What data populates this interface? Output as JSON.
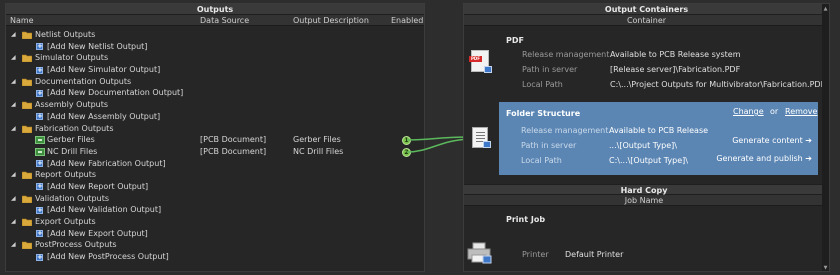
{
  "outputs_panel": {
    "title": "Outputs",
    "columns": {
      "name": "Name",
      "data_source": "Data Source",
      "output_description": "Output Description",
      "enabled": "Enabled"
    },
    "rows": [
      {
        "label": "Netlist Outputs",
        "type": "group"
      },
      {
        "label": "[Add New Netlist Output]",
        "type": "add"
      },
      {
        "label": "Simulator Outputs",
        "type": "group"
      },
      {
        "label": "[Add New Simulator Output]",
        "type": "add"
      },
      {
        "label": "Documentation Outputs",
        "type": "group"
      },
      {
        "label": "[Add New Documentation Output]",
        "type": "add"
      },
      {
        "label": "Assembly Outputs",
        "type": "group"
      },
      {
        "label": "[Add New Assembly Output]",
        "type": "add"
      },
      {
        "label": "Fabrication Outputs",
        "type": "group"
      },
      {
        "label": "Gerber Files",
        "type": "output",
        "data_source": "[PCB Document]",
        "description": "Gerber Files",
        "marker": "1"
      },
      {
        "label": "NC Drill Files",
        "type": "output",
        "data_source": "[PCB Document]",
        "description": "NC Drill Files",
        "marker": "2"
      },
      {
        "label": "[Add New Fabrication Output]",
        "type": "add"
      },
      {
        "label": "Report Outputs",
        "type": "group"
      },
      {
        "label": "[Add New Report Output]",
        "type": "add"
      },
      {
        "label": "Validation Outputs",
        "type": "group"
      },
      {
        "label": "[Add New Validation Output]",
        "type": "add"
      },
      {
        "label": "Export Outputs",
        "type": "group"
      },
      {
        "label": "[Add New Export Output]",
        "type": "add"
      },
      {
        "label": "PostProcess Outputs",
        "type": "group"
      },
      {
        "label": "[Add New PostProcess Output]",
        "type": "add"
      }
    ]
  },
  "containers_panel": {
    "title": "Output Containers",
    "subheader": "Container",
    "pdf": {
      "title": "PDF",
      "icon": "pdf-file-icon",
      "release_key": "Release management",
      "release_val": "Available to PCB Release system",
      "path_key": "Path in server",
      "path_val": "[Release server]\\Fabrication.PDF",
      "local_key": "Local Path",
      "local_val": "C:\\...\\Project Outputs for Multivibrator\\Fabrication.PDF"
    },
    "folder": {
      "title": "Folder Structure",
      "icon": "folder-structure-icon",
      "change": "Change",
      "or": "or",
      "remove": "Remove",
      "release_key": "Release management",
      "release_val": "Available to PCB Release",
      "path_key": "Path in server",
      "path_val": "...\\[Output Type]\\",
      "local_key": "Local Path",
      "local_val": "C:\\...\\[Output Type]\\",
      "generate_content": "Generate content ➔",
      "generate_publish": "Generate and publish ➔",
      "highlight_color": "#5b86b4"
    },
    "hard_copy": {
      "title": "Hard Copy",
      "subheader": "Job Name",
      "print_job": "Print Job",
      "icon": "printer-icon",
      "printer_key": "Printer",
      "printer_val": "Default Printer"
    }
  },
  "connector_color": "#5cb85c"
}
